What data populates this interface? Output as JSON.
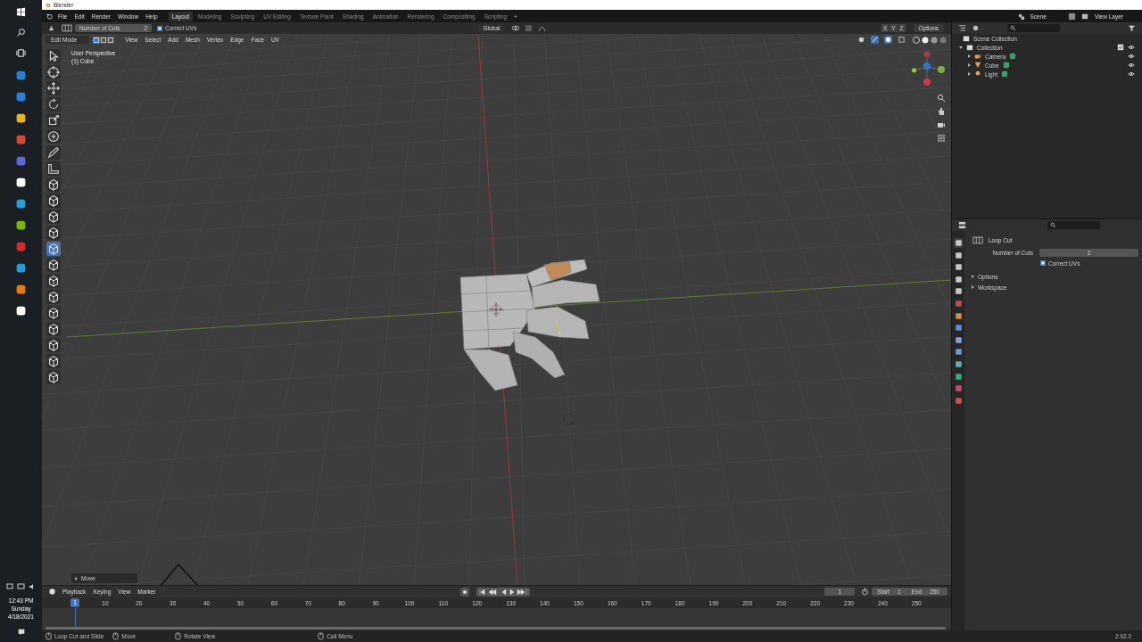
{
  "title_bar": {
    "title": "Blender"
  },
  "menu_bar": {
    "menus": [
      "File",
      "Edit",
      "Render",
      "Window",
      "Help"
    ],
    "workspaces": [
      {
        "label": "Layout",
        "selected": true
      },
      {
        "label": "Modeling",
        "selected": false
      },
      {
        "label": "Sculpting",
        "selected": false
      },
      {
        "label": "UV Editing",
        "selected": false
      },
      {
        "label": "Texture Paint",
        "selected": false
      },
      {
        "label": "Shading",
        "selected": false
      },
      {
        "label": "Animation",
        "selected": false
      },
      {
        "label": "Rendering",
        "selected": false
      },
      {
        "label": "Compositing",
        "selected": false
      },
      {
        "label": "Scripting",
        "selected": false
      }
    ],
    "add_workspace": "+",
    "scene": "Scene",
    "view_layer": "View Layer"
  },
  "tool_header": {
    "cuts_label": "Number of Cuts",
    "cuts_value": "2",
    "correct_uvs_label": "Correct UVs",
    "correct_uvs_checked": true,
    "orientation": "Global",
    "axes": [
      "X",
      "Y",
      "Z"
    ],
    "options": "Options"
  },
  "viewport_header": {
    "mode": "Edit Mode",
    "select_modes": [
      {
        "selected": true
      },
      {
        "selected": false
      },
      {
        "selected": false
      }
    ],
    "menus": [
      "View",
      "Select",
      "Add",
      "Mesh",
      "Vertex",
      "Edge",
      "Face",
      "UV"
    ]
  },
  "toolbar": {
    "tools": [
      {
        "selected": false
      },
      {
        "selected": false
      },
      {
        "selected": false
      },
      {
        "selected": false
      },
      {
        "selected": false
      },
      {
        "selected": false
      },
      {
        "selected": false
      },
      {
        "selected": false
      },
      {
        "selected": false
      },
      {
        "selected": false
      },
      {
        "selected": false
      },
      {
        "selected": false
      },
      {
        "selected": true
      },
      {
        "selected": false
      },
      {
        "selected": false
      },
      {
        "selected": false
      },
      {
        "selected": false
      },
      {
        "selected": false
      },
      {
        "selected": false
      },
      {
        "selected": false
      },
      {
        "selected": false
      }
    ]
  },
  "viewport": {
    "view_name": "User Perspective",
    "object_name": "(1) Cube",
    "last_operator": "Move",
    "last_operator_expanded": false
  },
  "taskbar": {
    "time": "12:43 PM",
    "day": "Sunday",
    "date": "4/18/2021"
  },
  "outliner": {
    "root": "Scene Collection",
    "tree": [
      {
        "label": "Collection",
        "kind": "collection",
        "expanded": true,
        "checked": true,
        "children": [
          {
            "label": "Camera",
            "kind": "camera",
            "expanded": false
          },
          {
            "label": "Cube",
            "kind": "mesh",
            "expanded": false
          },
          {
            "label": "Light",
            "kind": "light",
            "expanded": false
          }
        ]
      }
    ]
  },
  "properties": {
    "tabs": [
      {
        "selected": true
      },
      {
        "selected": false
      },
      {
        "selected": false
      },
      {
        "selected": false
      },
      {
        "selected": false
      },
      {
        "selected": false
      },
      {
        "selected": false
      },
      {
        "selected": false
      },
      {
        "selected": false
      },
      {
        "selected": false
      },
      {
        "selected": false
      },
      {
        "selected": false
      },
      {
        "selected": false
      },
      {
        "selected": false
      }
    ],
    "panel_title": "Loop Cut",
    "cuts_label": "Number of Cuts",
    "cuts_value": "2",
    "correct_uvs_label": "Correct UVs",
    "correct_uvs_checked": true,
    "sections": [
      {
        "label": "Options",
        "expanded": false
      },
      {
        "label": "Workspace",
        "expanded": false
      }
    ]
  },
  "timeline": {
    "menus": [
      "Playback",
      "Keying",
      "View",
      "Marker"
    ],
    "current_frame": "1",
    "start_label": "Start",
    "start": "1",
    "end_label": "End",
    "end": "250",
    "marker": "1",
    "frames": [
      "10",
      "20",
      "30",
      "40",
      "50",
      "60",
      "70",
      "80",
      "90",
      "100",
      "110",
      "120",
      "130",
      "140",
      "150",
      "160",
      "170",
      "180",
      "190",
      "200",
      "210",
      "220",
      "230",
      "240",
      "250"
    ]
  },
  "status_bar": {
    "hints": [
      "Loop Cut and Slide",
      "Move",
      "Rotate View",
      "Call Menu"
    ],
    "version": "2.92.0"
  }
}
